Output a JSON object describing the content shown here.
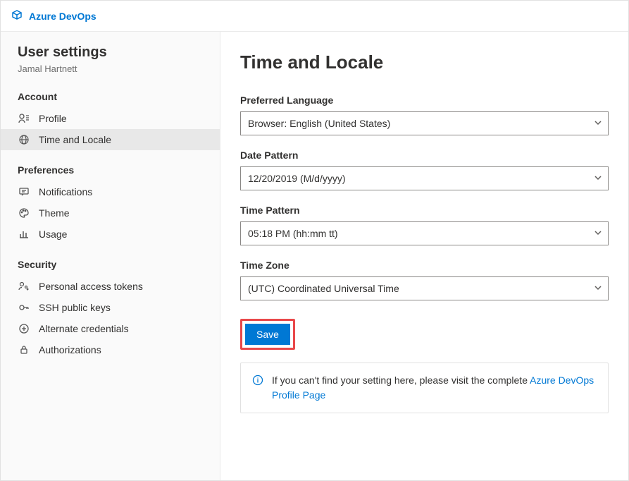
{
  "brand": "Azure DevOps",
  "sidebar": {
    "title": "User settings",
    "user": "Jamal Hartnett",
    "sections": {
      "account": {
        "header": "Account",
        "items": [
          "Profile",
          "Time and Locale"
        ]
      },
      "preferences": {
        "header": "Preferences",
        "items": [
          "Notifications",
          "Theme",
          "Usage"
        ]
      },
      "security": {
        "header": "Security",
        "items": [
          "Personal access tokens",
          "SSH public keys",
          "Alternate credentials",
          "Authorizations"
        ]
      }
    }
  },
  "page": {
    "title": "Time and Locale",
    "fields": {
      "language": {
        "label": "Preferred Language",
        "value": "Browser: English (United States)"
      },
      "datePattern": {
        "label": "Date Pattern",
        "value": "12/20/2019 (M/d/yyyy)"
      },
      "timePattern": {
        "label": "Time Pattern",
        "value": "05:18 PM (hh:mm tt)"
      },
      "timeZone": {
        "label": "Time Zone",
        "value": "(UTC) Coordinated Universal Time"
      }
    },
    "saveLabel": "Save",
    "callout": {
      "textBefore": "If you can't find your setting here, please visit the complete ",
      "linkText": "Azure DevOps Profile Page"
    }
  }
}
